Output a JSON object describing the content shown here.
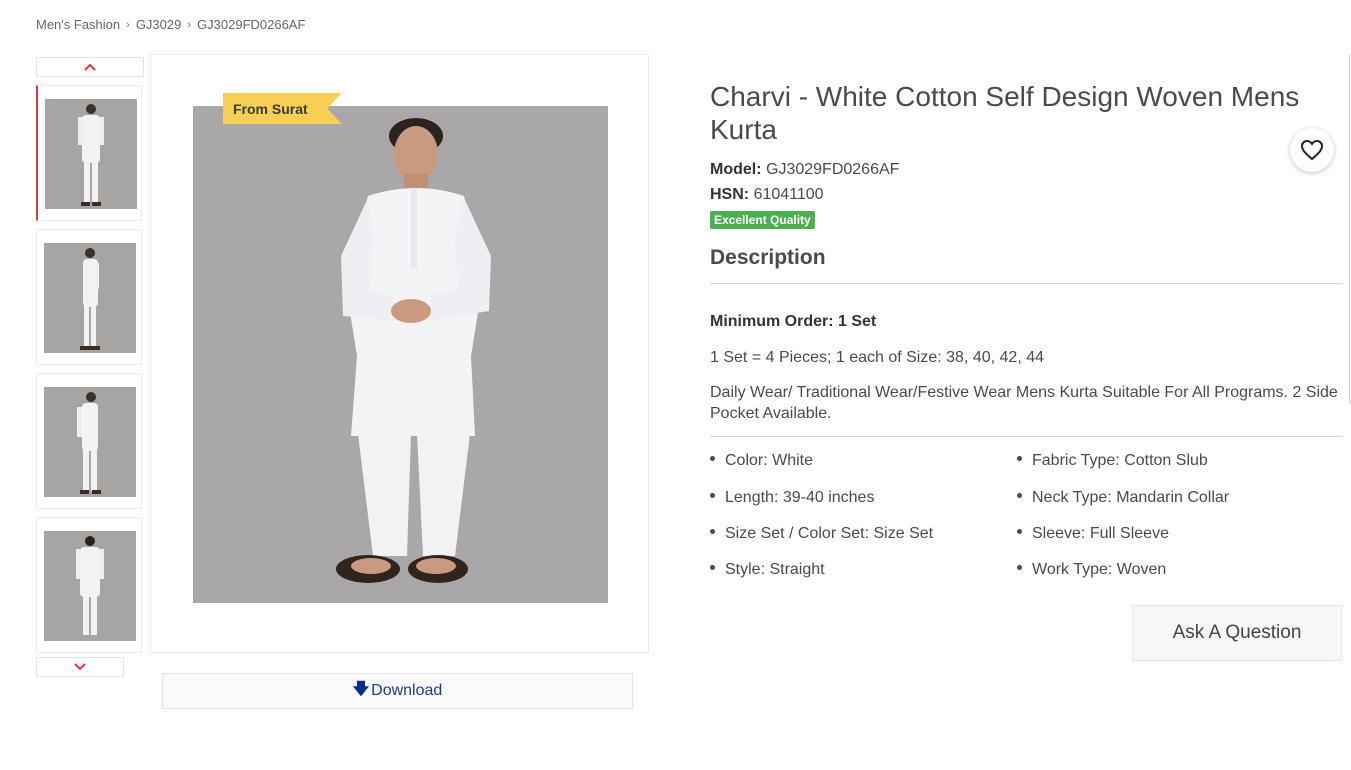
{
  "breadcrumb": {
    "items": [
      "Men's Fashion",
      "GJ3029",
      "GJ3029FD0266AF"
    ]
  },
  "gallery": {
    "origin_tag": "From Surat",
    "download_label": "Download",
    "thumb_count": 4
  },
  "product": {
    "title": "Charvi - White Cotton Self Design Woven Mens Kurta",
    "model_label": "Model:",
    "model_value": "GJ3029FD0266AF",
    "hsn_label": "HSN:",
    "hsn_value": "61041100",
    "quality_badge": "Excellent Quality",
    "description_heading": "Description",
    "min_order": "Minimum Order: 1 Set",
    "set_info": "1 Set = 4 Pieces; 1 each of Size: 38, 40, 42, 44",
    "description": "Daily Wear/ Traditional Wear/Festive Wear Mens Kurta Suitable For All Programs. 2 Side Pocket Available.",
    "specs_left": [
      "Color: White",
      "Length: 39-40 inches",
      "Size Set / Color Set: Size Set",
      "Style: Straight"
    ],
    "specs_right": [
      "Fabric Type: Cotton Slub",
      "Neck Type: Mandarin Collar",
      "Sleeve: Full Sleeve",
      "Work Type: Woven"
    ],
    "ask_button": "Ask A Question"
  },
  "icons": {
    "favorite": "heart-icon",
    "scroll_up": "chevron-up-icon",
    "scroll_down": "chevron-down-icon",
    "download": "arrow-down-icon"
  },
  "colors": {
    "accent_red": "#e23340",
    "badge_green": "#4caf50",
    "tag_yellow": "#f7cf55",
    "link_blue": "#1e3a8a"
  }
}
